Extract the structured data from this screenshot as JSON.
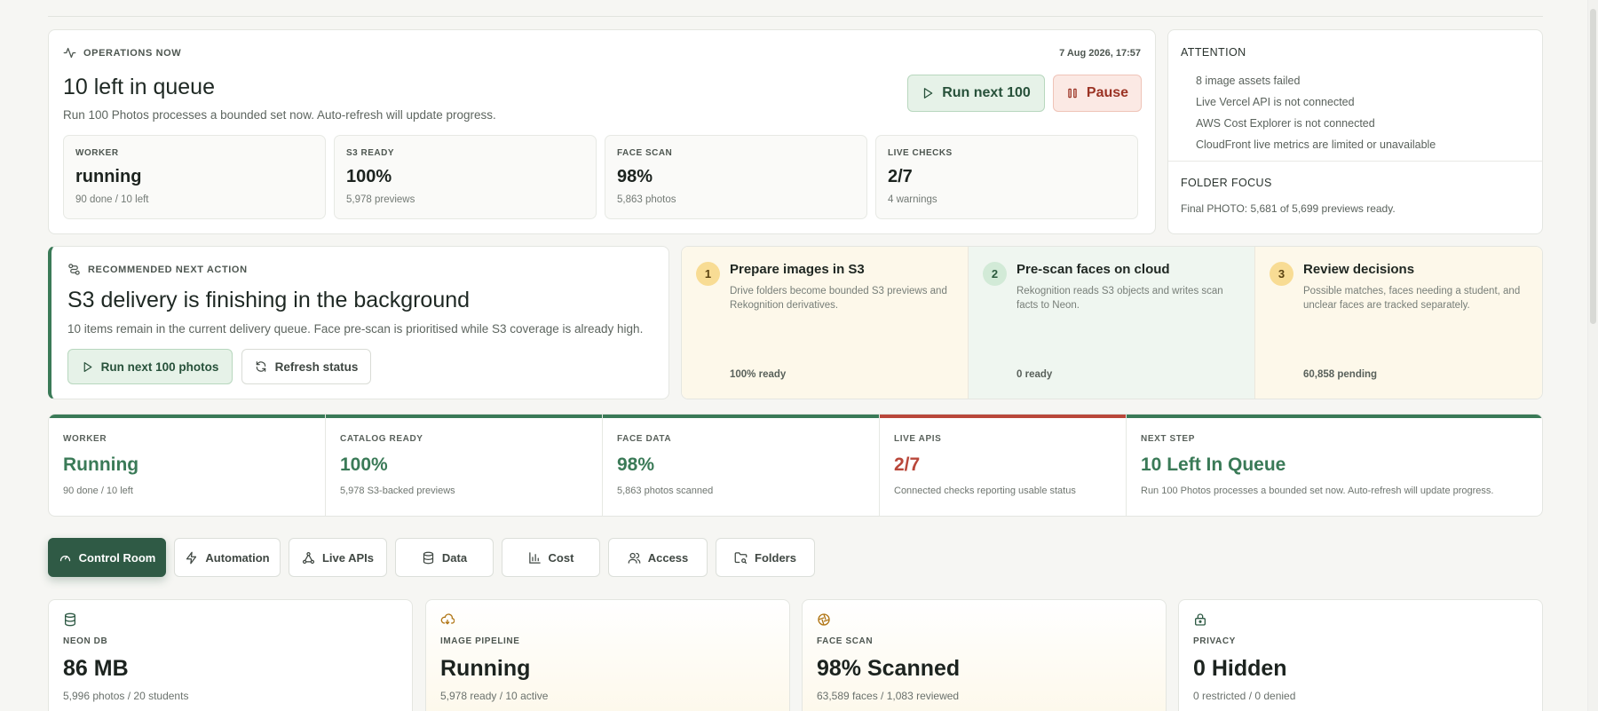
{
  "operations": {
    "eyebrow": "OPERATIONS NOW",
    "timestamp": "7 Aug 2026, 17:57",
    "title": "10 left in queue",
    "description": "Run 100 Photos processes a bounded set now. Auto-refresh will update progress.",
    "run_button": "Run next 100",
    "pause_button": "Pause",
    "stats": [
      {
        "label": "WORKER",
        "value": "running",
        "sub": "90 done / 10 left"
      },
      {
        "label": "S3 READY",
        "value": "100%",
        "sub": "5,978 previews"
      },
      {
        "label": "FACE SCAN",
        "value": "98%",
        "sub": "5,863 photos"
      },
      {
        "label": "LIVE CHECKS",
        "value": "2/7",
        "sub": "4 warnings"
      }
    ]
  },
  "attention": {
    "title": "ATTENTION",
    "items": [
      "8 image assets failed",
      "Live Vercel API is not connected",
      "AWS Cost Explorer is not connected",
      "CloudFront live metrics are limited or unavailable"
    ],
    "folder_title": "FOLDER FOCUS",
    "folder_text": "Final PHOTO: 5,681 of 5,699 previews ready."
  },
  "recommend": {
    "eyebrow": "RECOMMENDED NEXT ACTION",
    "title": "S3 delivery is finishing in the background",
    "description": "10 items remain in the current delivery queue. Face pre-scan is prioritised while S3 coverage is already high.",
    "run_button": "Run next 100 photos",
    "refresh_button": "Refresh status"
  },
  "steps": [
    {
      "num": "1",
      "title": "Prepare images in S3",
      "desc": "Drive folders become bounded S3 previews and Rekognition derivatives.",
      "foot": "100% ready",
      "bg": "#fdf8ea",
      "badge": "#f8dc94",
      "badge_text": "#5a4210"
    },
    {
      "num": "2",
      "title": "Pre-scan faces on cloud",
      "desc": "Rekognition reads S3 objects and writes scan facts to Neon.",
      "foot": "0 ready",
      "bg": "#eff6f0",
      "badge": "#d2ead7",
      "badge_text": "#2b5a3d"
    },
    {
      "num": "3",
      "title": "Review decisions",
      "desc": "Possible matches, faces needing a student, and unclear faces are tracked separately.",
      "foot": "60,858 pending",
      "bg": "#fdf8ea",
      "badge": "#f8dc94",
      "badge_text": "#5a4210"
    }
  ],
  "metrics": [
    {
      "label": "WORKER",
      "value": "Running",
      "sub": "90 done / 10 left",
      "color": "#3a7a57"
    },
    {
      "label": "CATALOG READY",
      "value": "100%",
      "sub": "5,978 S3-backed previews",
      "color": "#3a7a57"
    },
    {
      "label": "FACE DATA",
      "value": "98%",
      "sub": "5,863 photos scanned",
      "color": "#3a7a57"
    },
    {
      "label": "LIVE APIS",
      "value": "2/7",
      "sub": "Connected checks reporting usable status",
      "color": "#b9473a"
    },
    {
      "label": "NEXT STEP",
      "value": "10 Left In Queue",
      "sub": "Run 100 Photos processes a bounded set now. Auto-refresh will update progress.",
      "color": "#3a7a57"
    }
  ],
  "tabs": [
    {
      "label": "Control Room",
      "icon": "gauge-icon",
      "active": true
    },
    {
      "label": "Automation",
      "icon": "bolt-icon"
    },
    {
      "label": "Live APIs",
      "icon": "network-icon"
    },
    {
      "label": "Data",
      "icon": "database-icon"
    },
    {
      "label": "Cost",
      "icon": "bar-chart-icon"
    },
    {
      "label": "Access",
      "icon": "users-icon"
    },
    {
      "label": "Folders",
      "icon": "folder-search-icon"
    }
  ],
  "cards": [
    {
      "label": "NEON DB",
      "value": "86 MB",
      "sub": "5,996 photos / 20 students",
      "icon": "database-icon",
      "icon_color": "#2f5a45"
    },
    {
      "label": "IMAGE PIPELINE",
      "value": "Running",
      "sub": "5,978 ready / 10 active",
      "icon": "cloud-sync-icon",
      "icon_color": "#b07514"
    },
    {
      "label": "FACE SCAN",
      "value": "98% Scanned",
      "sub": "63,589 faces / 1,083 reviewed",
      "icon": "aperture-icon",
      "icon_color": "#b07514"
    },
    {
      "label": "PRIVACY",
      "value": "0 Hidden",
      "sub": "0 restricted / 0 denied",
      "icon": "lock-icon",
      "icon_color": "#2f5a45"
    }
  ]
}
